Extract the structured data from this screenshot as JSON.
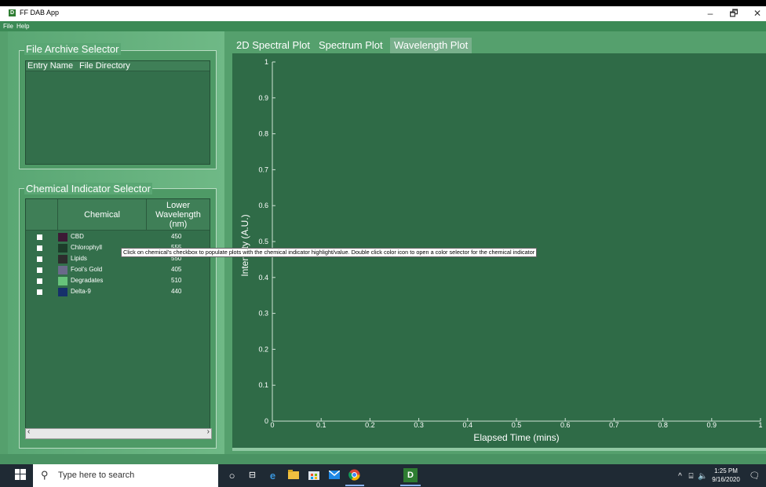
{
  "window": {
    "title": "FF DAB App",
    "minimize": "–",
    "restore": "🗗",
    "close": "✕"
  },
  "menu": [
    "File",
    "Help"
  ],
  "file_archive": {
    "title": "File Archive Selector",
    "columns": [
      "Entry Name",
      "File Directory"
    ]
  },
  "chemical_selector": {
    "title": "Chemical Indicator Selector",
    "columns": {
      "chemical": "Chemical",
      "lower": "Lower",
      "wavelength": "Wavelength",
      "unit": "(nm)"
    },
    "rows": [
      {
        "name": "CBD",
        "value": "450",
        "color": "#3d1a35"
      },
      {
        "name": "Chlorophyll",
        "value": "555",
        "color": "#1c3d2a"
      },
      {
        "name": "Lipids",
        "value": "550",
        "color": "#2d2d2d"
      },
      {
        "name": "Fool's Gold",
        "value": "405",
        "color": "#6a6a8a"
      },
      {
        "name": "Degradates",
        "value": "510",
        "color": "#66c37a"
      },
      {
        "name": "Delta-9",
        "value": "440",
        "color": "#16306b"
      }
    ]
  },
  "tabs": [
    "2D Spectral Plot",
    "Spectrum Plot",
    "Wavelength Plot"
  ],
  "active_tab": 2,
  "tooltip": "Click on chemical's checkbox to populate plots with the chemical indicator highlight/value. Double click color icon to open a color selector for the chemical indicator",
  "chart_data": {
    "type": "line",
    "series": [],
    "xlabel": "Elapsed Time (mins)",
    "ylabel": "Intensity (A.U.)",
    "xlim": [
      0,
      1
    ],
    "ylim": [
      0,
      1
    ],
    "xticks": [
      "0",
      "0.1",
      "0.2",
      "0.3",
      "0.4",
      "0.5",
      "0.6",
      "0.7",
      "0.8",
      "0.9",
      "1"
    ],
    "yticks": [
      "0",
      "0.1",
      "0.2",
      "0.3",
      "0.4",
      "0.5",
      "0.6",
      "0.7",
      "0.8",
      "0.9",
      "1"
    ],
    "grid": false
  },
  "taskbar": {
    "search_placeholder": "Type here to search",
    "time": "1:25 PM",
    "date": "9/16/2020"
  }
}
